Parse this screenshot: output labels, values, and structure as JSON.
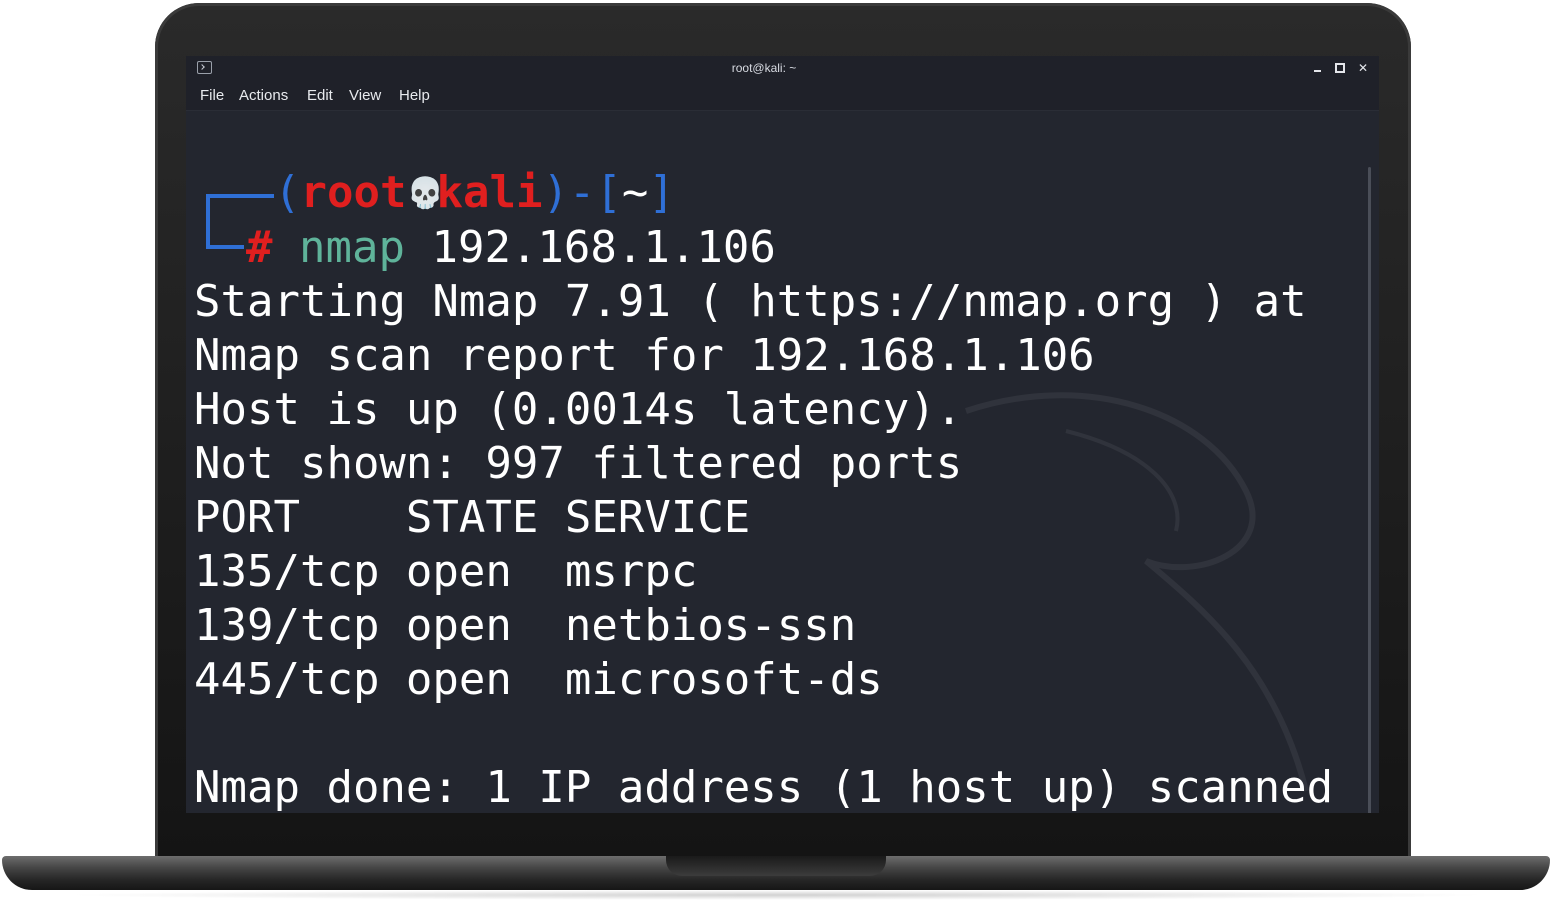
{
  "window": {
    "title": "root@kali: ~",
    "icon": "terminal-icon",
    "controls": {
      "minimize": "minimize-icon",
      "maximize": "maximize-icon",
      "close": "close-icon",
      "close_glyph": "✕"
    }
  },
  "menu": {
    "file": "File",
    "actions": "Actions",
    "edit": "Edit",
    "view": "View",
    "help": "Help"
  },
  "prompt": {
    "open_paren": "(",
    "user": "root",
    "skull": "💀",
    "host": "kali",
    "separator": ")-[",
    "dir": "~",
    "close_bracket": "]",
    "hash": "#",
    "command": "nmap",
    "argument": "192.168.1.106"
  },
  "output": [
    "Starting Nmap 7.91 ( https://nmap.org ) at",
    "Nmap scan report for 192.168.1.106",
    "Host is up (0.0014s latency).",
    "Not shown: 997 filtered ports",
    "PORT    STATE SERVICE",
    "135/tcp open  msrpc",
    "139/tcp open  netbios-ssn",
    "445/tcp open  microsoft-ds",
    "",
    "Nmap done: 1 IP address (1 host up) scanned"
  ],
  "colors": {
    "background": "#23262f",
    "prompt_box": "#2f6fd6",
    "prompt_user": "#e01f1f",
    "command": "#5fb39a",
    "text": "#ffffff"
  }
}
